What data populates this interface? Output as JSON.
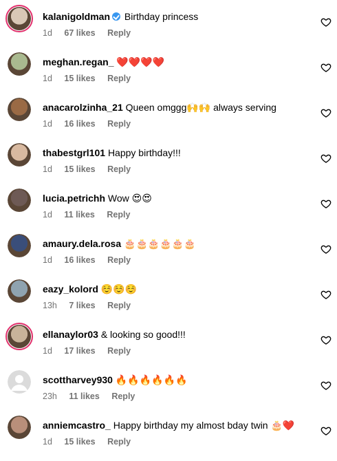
{
  "comments": [
    {
      "username": "kalanigoldman",
      "verified": true,
      "text": "Birthday princess",
      "time": "1d",
      "likes": "67 likes",
      "reply": "Reply",
      "avatar_ring": true,
      "avatar_color": "#d9c7b6"
    },
    {
      "username": "meghan.regan_",
      "verified": false,
      "text": "❤️❤️❤️❤️",
      "time": "1d",
      "likes": "15 likes",
      "reply": "Reply",
      "avatar_ring": false,
      "avatar_color": "#a9b98f"
    },
    {
      "username": "anacarolzinha_21",
      "verified": false,
      "text": "Queen omggg🙌🙌 always serving",
      "time": "1d",
      "likes": "16 likes",
      "reply": "Reply",
      "avatar_ring": false,
      "avatar_color": "#9a6a45"
    },
    {
      "username": "thabestgrl101",
      "verified": false,
      "text": "Happy birthday!!!",
      "time": "1d",
      "likes": "15 likes",
      "reply": "Reply",
      "avatar_ring": false,
      "avatar_color": "#d8b9a0"
    },
    {
      "username": "lucia.petrichh",
      "verified": false,
      "text": "Wow 😍😍",
      "time": "1d",
      "likes": "11 likes",
      "reply": "Reply",
      "avatar_ring": false,
      "avatar_color": "#6e5a55"
    },
    {
      "username": "amaury.dela.rosa",
      "verified": false,
      "text": "🎂🎂🎂🎂🎂🎂",
      "time": "1d",
      "likes": "16 likes",
      "reply": "Reply",
      "avatar_ring": false,
      "avatar_color": "#3a4e7a"
    },
    {
      "username": "eazy_kolord",
      "verified": false,
      "text": "☺️☺️☺️",
      "time": "13h",
      "likes": "7 likes",
      "reply": "Reply",
      "avatar_ring": false,
      "avatar_color": "#8fa3b0"
    },
    {
      "username": "ellanaylor03",
      "verified": false,
      "text": "& looking so good!!!",
      "time": "1d",
      "likes": "17 likes",
      "reply": "Reply",
      "avatar_ring": true,
      "avatar_color": "#c9b39a"
    },
    {
      "username": "scottharvey930",
      "verified": false,
      "text": "🔥🔥🔥🔥🔥🔥",
      "time": "23h",
      "likes": "11 likes",
      "reply": "Reply",
      "avatar_ring": false,
      "avatar_color": "#c7c7c7",
      "avatar_default": true
    },
    {
      "username": "anniemcastro_",
      "verified": false,
      "text": "Happy birthday my almost bday twin 🎂❤️",
      "time": "1d",
      "likes": "15 likes",
      "reply": "Reply",
      "avatar_ring": false,
      "avatar_color": "#b98f7a"
    }
  ],
  "icons": {
    "like": "heart-outline-icon",
    "verified": "verified-badge-icon"
  }
}
